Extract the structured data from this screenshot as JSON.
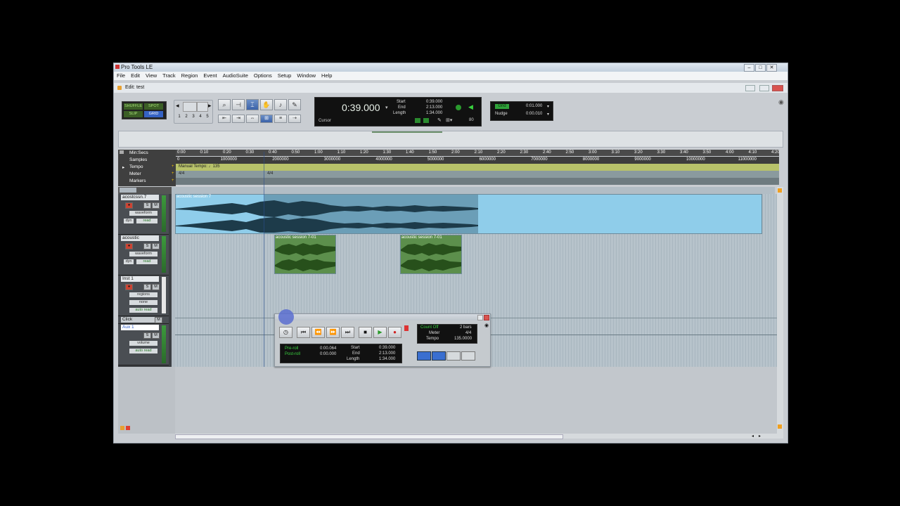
{
  "window": {
    "title": "Pro Tools LE",
    "edit_title": "Edit: test"
  },
  "menu": [
    "File",
    "Edit",
    "View",
    "Track",
    "Region",
    "Event",
    "AudioSuite",
    "Options",
    "Setup",
    "Window",
    "Help"
  ],
  "edit_modes": {
    "shuffle": "SHUFFLE",
    "spot": "SPOT",
    "slip": "SLIP",
    "grid": "GRID"
  },
  "zoom_presets": [
    "1",
    "2",
    "3",
    "4",
    "5"
  ],
  "main_counter": {
    "value": "0:39.000",
    "label": "Cursor",
    "start_label": "Start",
    "end_label": "End",
    "length_label": "Length",
    "start": "0:39.000",
    "end": "2:13.000",
    "length": "1:34.000",
    "bpm": "80"
  },
  "grid_nudge": {
    "grid_label": "Grid",
    "nudge_label": "Nudge",
    "grid_value": "0:01.000",
    "nudge_value": "0:00.010"
  },
  "rulers": {
    "labels": [
      "Min:Secs",
      "Samples",
      "Tempo",
      "Meter",
      "Markers"
    ],
    "minsecs": [
      "0:00",
      "0:10",
      "0:20",
      "0:30",
      "0:40",
      "0:50",
      "1:00",
      "1:10",
      "1:20",
      "1:30",
      "1:40",
      "1:50",
      "2:00",
      "2:10",
      "2:20",
      "2:30",
      "2:40",
      "2:50",
      "3:00",
      "3:10",
      "3:20",
      "3:30",
      "3:40",
      "3:50",
      "4:00",
      "4:10",
      "4:20"
    ],
    "samples": [
      "0",
      "1000000",
      "2000000",
      "3000000",
      "4000000",
      "5000000",
      "6000000",
      "7000000",
      "8000000",
      "9000000",
      "10000000",
      "11000000"
    ],
    "tempo_text": "Manual Tempo: ♩135",
    "meter_start": "4/4",
    "meter_mark": "4/4"
  },
  "tracks": [
    {
      "name": "acostcssn.7",
      "view": "waveform",
      "dyn": "dyn",
      "auto": "read"
    },
    {
      "name": "acoustic",
      "view": "waveform",
      "dyn": "dyn",
      "auto": "read"
    },
    {
      "name": "Inst 1",
      "view": "regions",
      "dyn": "none",
      "auto": "auto read"
    },
    {
      "name": "Click",
      "view": "",
      "dyn": "",
      "auto": ""
    },
    {
      "name": "Aux 1",
      "view": "volume",
      "dyn": "",
      "auto": "auto read"
    }
  ],
  "regions": [
    {
      "name": "acoustic session 7"
    },
    {
      "name": "acoustic session 7-01"
    },
    {
      "name": "acoustic session 7-01"
    }
  ],
  "transport": {
    "preroll_label": "Pre-roll",
    "postroll_label": "Post-roll",
    "preroll": "0:00.064",
    "postroll": "0:00.000",
    "start_label": "Start",
    "end_label": "End",
    "length_label": "Length",
    "start": "0:39.000",
    "end": "2:13.000",
    "length": "1:34.000",
    "count_off": "Count Off",
    "bars": "2 bars",
    "meter_label": "Meter",
    "meter": "4/4",
    "tempo_label": "Tempo",
    "tempo": "135.0000"
  },
  "colors": {
    "region_blue": "#8fcdea",
    "region_selected": "#2f4a5a",
    "green_wave": "#3d7a2a",
    "tempo_ruler": "#b8c26a"
  }
}
